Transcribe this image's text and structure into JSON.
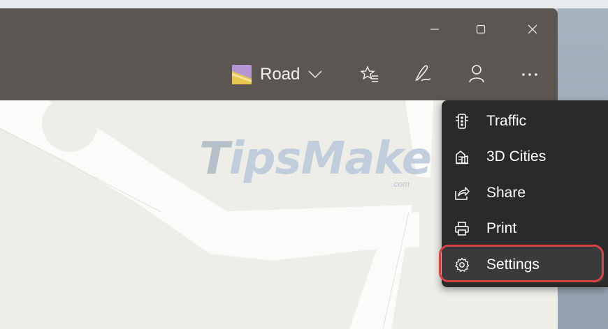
{
  "window": {
    "caption": {
      "minimize": "–",
      "maximize": "☐",
      "close": "✕"
    }
  },
  "toolbar": {
    "map_style_label": "Road",
    "icons": [
      "map-style-thumbnail-icon",
      "chevron-down-icon",
      "favorites-icon",
      "ink-pen-icon",
      "account-icon",
      "more-icon"
    ]
  },
  "watermark": {
    "text_lead": "T",
    "text_main": "ipsMake",
    "suffix": ".com"
  },
  "menu": {
    "items": [
      {
        "label": "Traffic",
        "icon": "traffic-light-icon"
      },
      {
        "label": "3D Cities",
        "icon": "3d-buildings-icon"
      },
      {
        "label": "Share",
        "icon": "share-icon"
      },
      {
        "label": "Print",
        "icon": "printer-icon"
      },
      {
        "label": "Settings",
        "icon": "gear-icon"
      }
    ],
    "highlight_color": "#d94343"
  }
}
